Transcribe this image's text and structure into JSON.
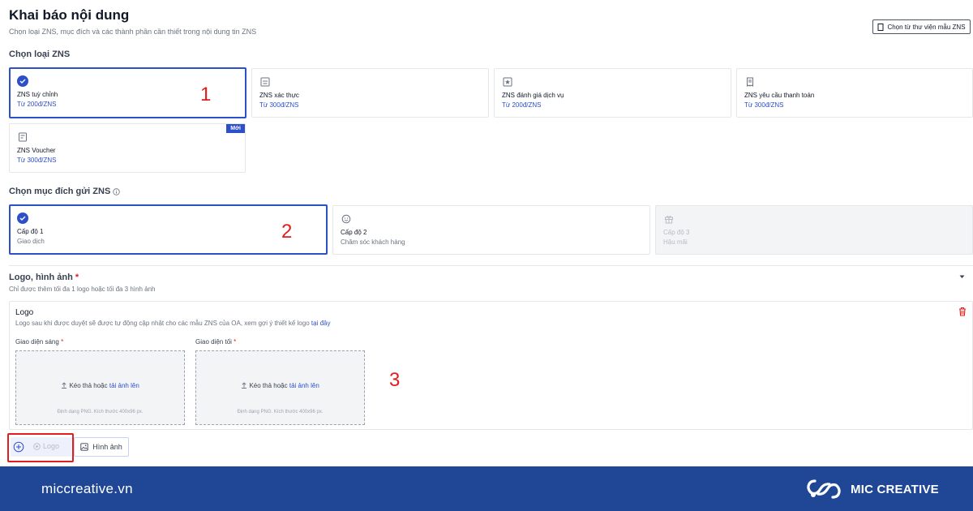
{
  "header": {
    "title": "Khai báo nội dung",
    "subtitle": "Chọn loại ZNS, mục đích và các thành phần cần thiết trong nội dung tin ZNS",
    "library_button": "Chọn từ thư viện mẫu ZNS"
  },
  "zns_types": {
    "title": "Chọn loại ZNS",
    "items": [
      {
        "name": "ZNS tuỳ chỉnh",
        "price": "Từ 200đ/ZNS",
        "icon": "check-icon",
        "selected": true
      },
      {
        "name": "ZNS xác thực",
        "price": "Từ 300đ/ZNS",
        "icon": "keypad-icon"
      },
      {
        "name": "ZNS đánh giá dịch vụ",
        "price": "Từ 200đ/ZNS",
        "icon": "star-box-icon"
      },
      {
        "name": "ZNS yêu cầu thanh toán",
        "price": "Từ 300đ/ZNS",
        "icon": "receipt-icon"
      },
      {
        "name": "ZNS Voucher",
        "price": "Từ 300đ/ZNS",
        "icon": "voucher-icon",
        "badge": "Mới"
      }
    ]
  },
  "purpose": {
    "title": "Chọn mục đích gửi ZNS",
    "items": [
      {
        "name": "Cấp độ 1",
        "desc": "Giao dịch",
        "icon": "check-icon",
        "selected": true
      },
      {
        "name": "Cấp độ 2",
        "desc": "Chăm sóc khách hàng",
        "icon": "smile-icon"
      },
      {
        "name": "Cấp độ 3",
        "desc": "Hậu mãi",
        "icon": "gift-icon",
        "disabled": true
      }
    ]
  },
  "annotations": [
    "1",
    "2",
    "3"
  ],
  "logo_section": {
    "title": "Logo, hình ảnh",
    "required_mark": "*",
    "subtitle": "Chỉ được thêm tối đa 1 logo hoặc tối đa 3 hình ảnh",
    "panel": {
      "title": "Logo",
      "note": "Logo sau khi được duyệt sẽ được tự động cập nhật cho các mẫu ZNS của OA, xem gợi ý thiết kế logo",
      "note_link": "tại đây",
      "light_label": "Giao diện sáng",
      "dark_label": "Giao diện tối",
      "drop_text": "Kéo thả hoặc",
      "drop_link": "tải ảnh lên",
      "format_hint": "Định dạng PNG. Kích thước 400x96 px."
    },
    "add_logo": "Logo",
    "add_image": "Hình ảnh"
  },
  "footer": {
    "site": "miccreative.vn",
    "brand": "MIC CREATIVE"
  },
  "colors": {
    "accent": "#2d4fc9",
    "annotation": "#e11d1d",
    "footer_bg": "#1f4796"
  }
}
